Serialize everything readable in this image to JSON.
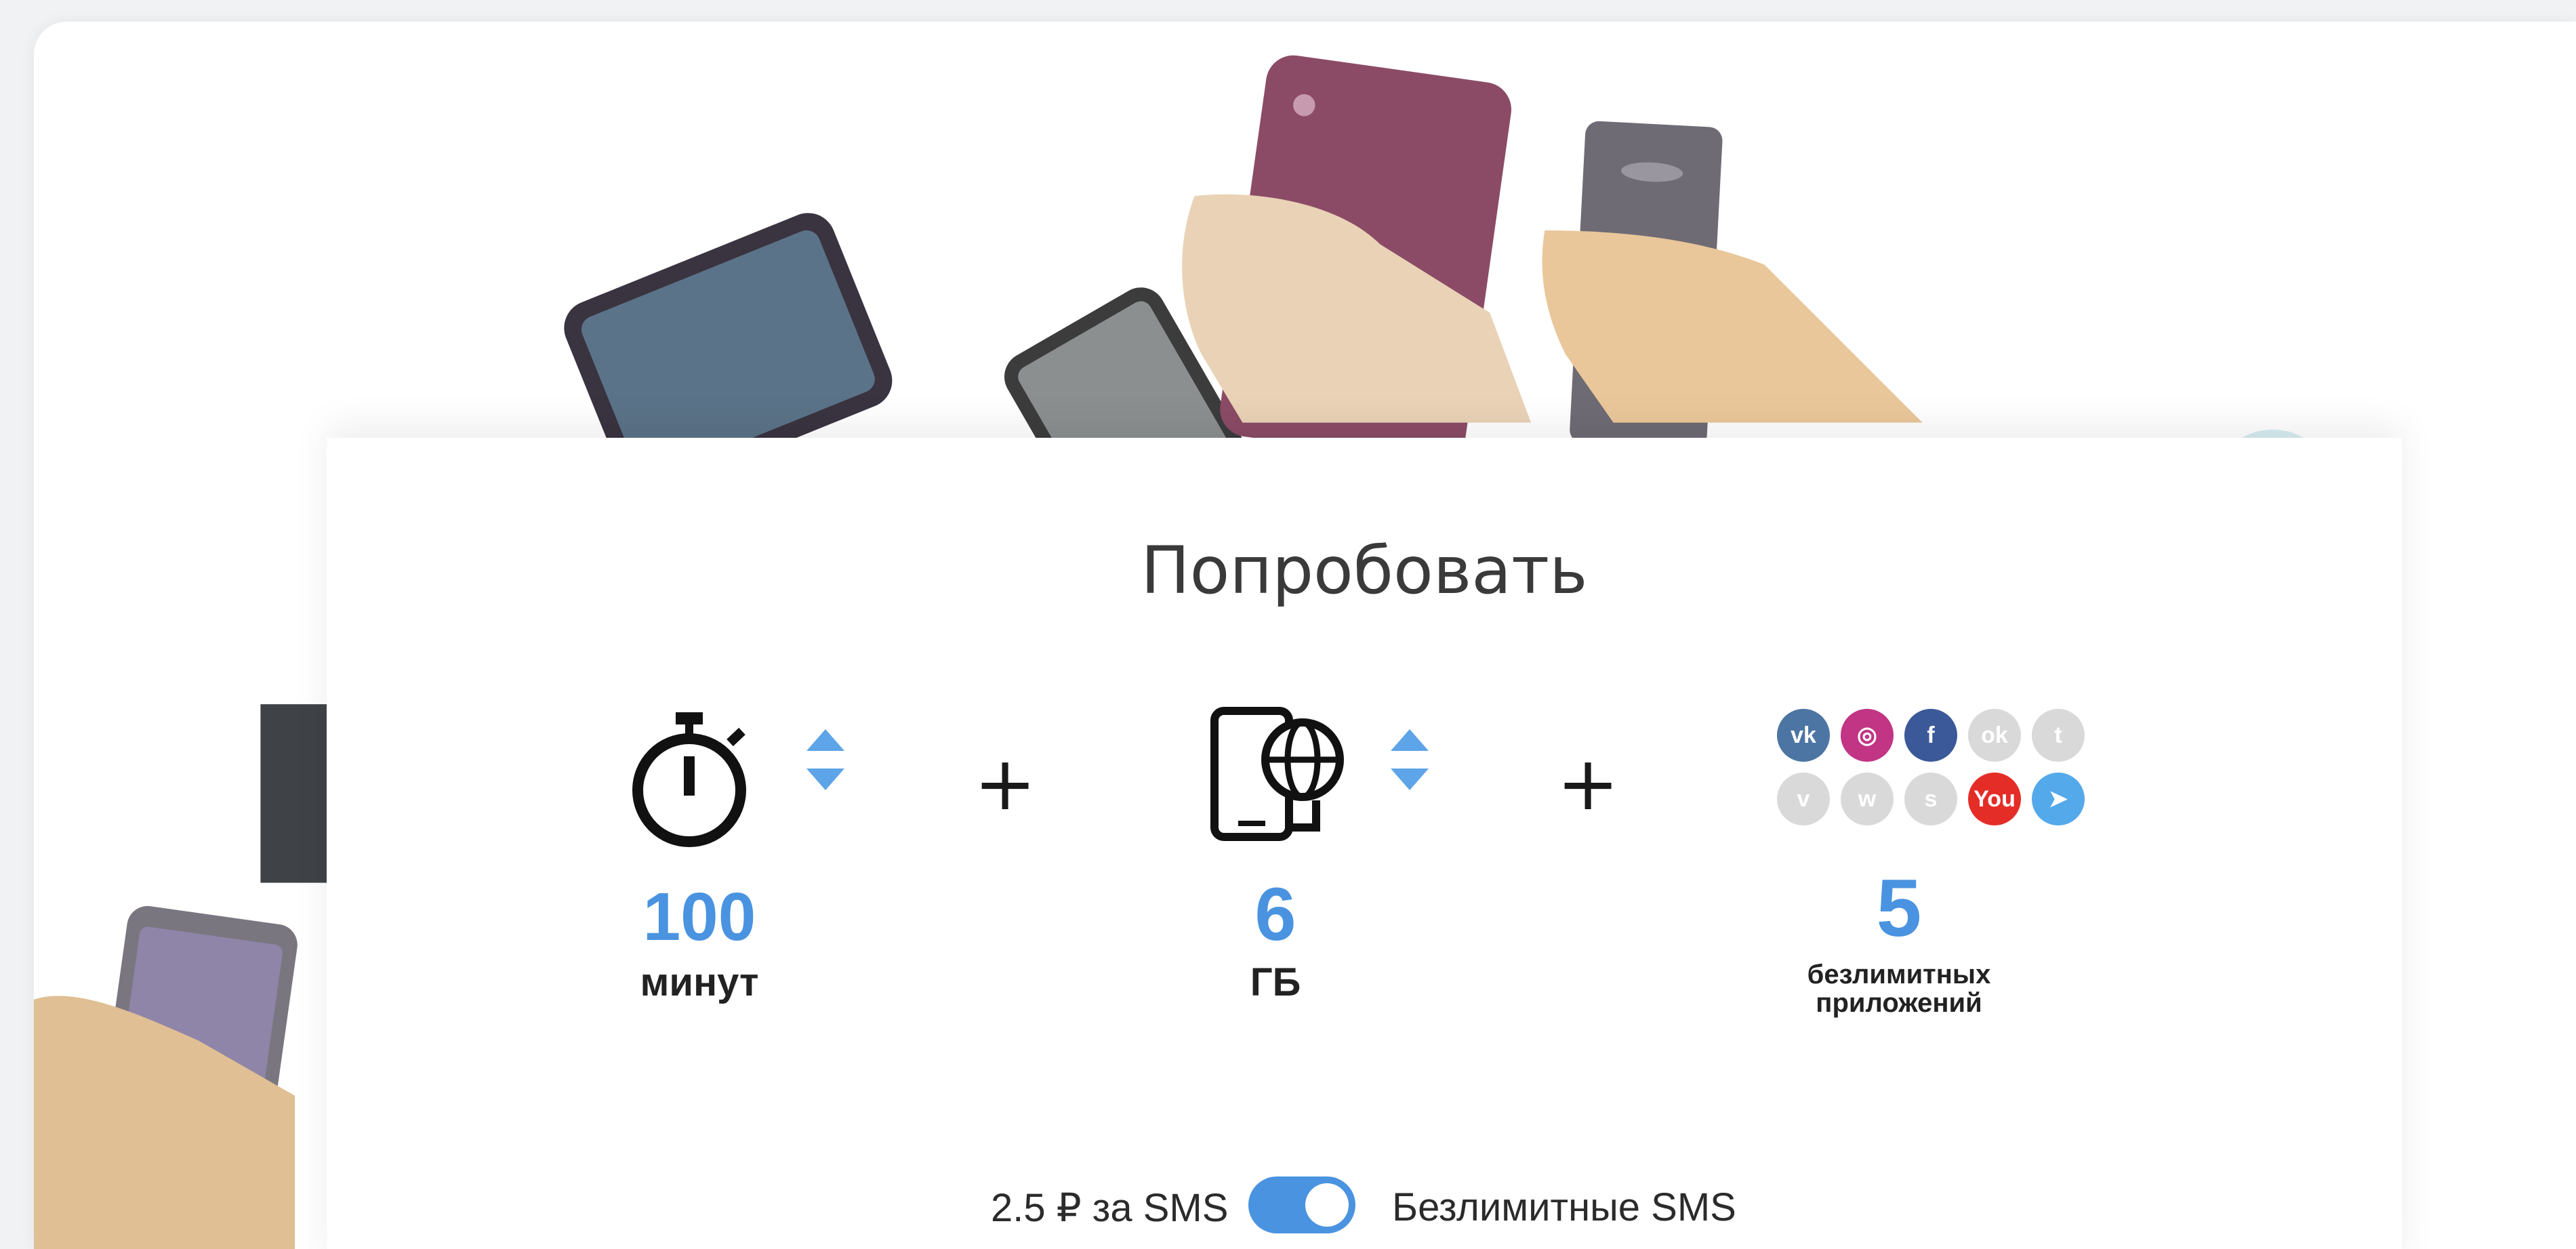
{
  "tariff": {
    "title": "Попробовать",
    "minutes": {
      "value": "100",
      "unit": "минут",
      "icon": "stopwatch-icon"
    },
    "data": {
      "value": "6",
      "unit": "ГБ",
      "icon": "phone-globe-icon"
    },
    "apps": {
      "value": "5",
      "unit_line1": "безлимитных",
      "unit_line2": "приложений"
    },
    "plus": "+",
    "sms": {
      "left_label": "2.5 ₽ за SMS",
      "right_label": "Безлимитные SMS",
      "toggle_on": true
    }
  },
  "apps_grid": [
    {
      "name": "vk-icon",
      "label": "vk",
      "color": "#4c75a3",
      "active": true
    },
    {
      "name": "instagram-icon",
      "label": "◎",
      "color": "#c13584",
      "active": true
    },
    {
      "name": "facebook-icon",
      "label": "f",
      "color": "#3b5998",
      "active": true
    },
    {
      "name": "odnoklassniki-icon",
      "label": "ok",
      "color": "#d9d9d9",
      "active": false
    },
    {
      "name": "twitter-icon",
      "label": "t",
      "color": "#d9d9d9",
      "active": false
    },
    {
      "name": "viber-icon",
      "label": "v",
      "color": "#d9d9d9",
      "active": false
    },
    {
      "name": "whatsapp-icon",
      "label": "w",
      "color": "#d9d9d9",
      "active": false
    },
    {
      "name": "skype-icon",
      "label": "s",
      "color": "#d9d9d9",
      "active": false
    },
    {
      "name": "youtube-icon",
      "label": "You",
      "color": "#e52d27",
      "active": true
    },
    {
      "name": "telegram-icon",
      "label": "➤",
      "color": "#54a9eb",
      "active": true
    }
  ],
  "colors": {
    "accent": "#4a93e0",
    "text": "#222222"
  }
}
